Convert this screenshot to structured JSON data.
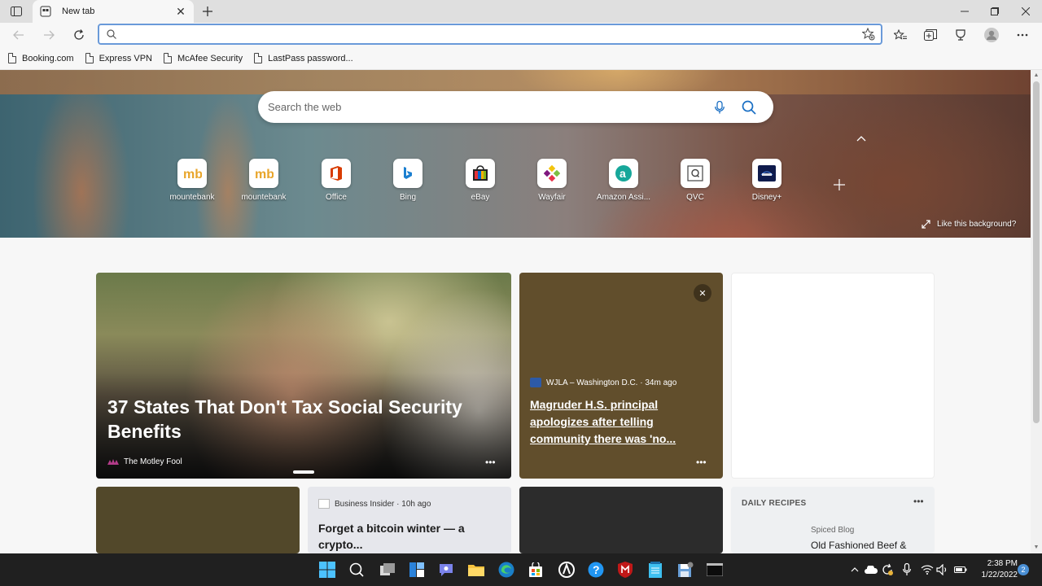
{
  "tabs": [
    {
      "title": "New tab"
    }
  ],
  "address_bar": {
    "value": "",
    "placeholder": ""
  },
  "bookmarks": [
    {
      "label": "Booking.com"
    },
    {
      "label": "Express VPN"
    },
    {
      "label": "McAfee Security"
    },
    {
      "label": "LastPass password..."
    }
  ],
  "hero": {
    "search_placeholder": "Search the web",
    "like_background": "Like this background?"
  },
  "quick_links": [
    {
      "label": "mountebank",
      "icon": "mb-icon"
    },
    {
      "label": "mountebank",
      "icon": "mb-icon"
    },
    {
      "label": "Office",
      "icon": "office-icon"
    },
    {
      "label": "Bing",
      "icon": "bing-icon"
    },
    {
      "label": "eBay",
      "icon": "ebay-icon"
    },
    {
      "label": "Wayfair",
      "icon": "wayfair-icon"
    },
    {
      "label": "Amazon Assi...",
      "icon": "amazon-assistant-icon"
    },
    {
      "label": "QVC",
      "icon": "qvc-icon"
    },
    {
      "label": "Disney+",
      "icon": "disney-plus-icon"
    }
  ],
  "feed": {
    "hero_card": {
      "headline": "37 States That Don't Tax Social Security Benefits",
      "source": "The Motley Fool"
    },
    "news_card": {
      "source": "WJLA – Washington D.C. · 34m ago",
      "headline": "Magruder H.S. principal apologizes after telling community there was 'no..."
    },
    "bi_card": {
      "source": "Business Insider · 10h ago",
      "headline": "Forget a bitcoin winter — a crypto..."
    },
    "recipe_card": {
      "heading": "DAILY RECIPES",
      "blog": "Spiced Blog",
      "title": "Old Fashioned Beef &"
    }
  },
  "taskbar": {
    "time": "2:38 PM",
    "date": "1/22/2022",
    "notifications": "2"
  },
  "colors": {
    "address_focus": "#6a9ad9",
    "news_card_bg": "#614e2c",
    "taskbar_bg": "#202020"
  }
}
